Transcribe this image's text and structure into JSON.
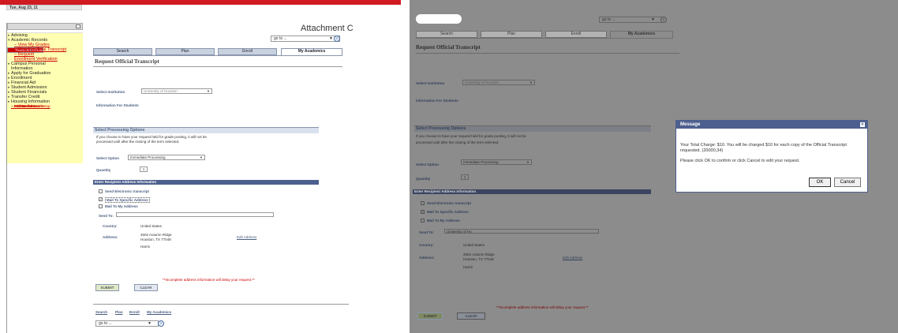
{
  "header": {
    "date": "Tue, Aug 23, 11",
    "attachment_label": "Attachment C"
  },
  "goto": {
    "value": "go to ...",
    "go_glyph": "»"
  },
  "nav": {
    "items": [
      {
        "label": "Advising",
        "arrow": "▸"
      },
      {
        "label": "Academic Records",
        "arrow": "▾"
      },
      {
        "label": "– View My Grades"
      },
      {
        "label": "– Request Official"
      },
      {
        "label": "Transcript"
      },
      {
        "label": "– View Unofficial Transcript"
      },
      {
        "label": "– Request"
      },
      {
        "label": "Enrollment Verification"
      },
      {
        "label": "Campus Personal",
        "arrow": "▸"
      },
      {
        "label": "Information"
      },
      {
        "label": "Apply for Graduation",
        "arrow": "▸"
      },
      {
        "label": "Enrollment",
        "arrow": "▸"
      },
      {
        "label": "Financial Aid",
        "arrow": "▸"
      },
      {
        "label": "Student Admission",
        "arrow": "▸"
      },
      {
        "label": "Student Financials",
        "arrow": "▸"
      },
      {
        "label": "Transfer Credit",
        "arrow": "▸"
      },
      {
        "label": "Housing Information",
        "arrow": "▸"
      },
      {
        "label": "– Student Center"
      },
      {
        "label": "– Password Reset/Setup"
      },
      {
        "label": "– ACS Website"
      },
      {
        "label": "– Self Service Home"
      }
    ]
  },
  "tabs": [
    "Search",
    "Plan",
    "Enroll",
    "My Academics"
  ],
  "page": {
    "title": "Request Official Transcript",
    "select_institution_label": "Select Institution",
    "institution_value": "University of Houston",
    "info_link": "Information For Students",
    "processing_section": "Select Processing Options",
    "processing_text_1": "If you choose to have your request held for grade posting, it will not be",
    "processing_text_2": "processed until after the closing of the term selected.",
    "select_option_label": "Select Option",
    "select_option_value": "Immediate Processing",
    "quantity_label": "Quantity",
    "quantity_value": "1",
    "address_section": "Enter Recipient Address Information",
    "opt_electronic": "Send Electronic transcript",
    "opt_mail_specific": "Mail To Specific Address",
    "opt_mail_my": "Mail To My Address",
    "send_to_label": "Send To:",
    "send_to_value_right": "University of Ho",
    "country_label": "Country:",
    "country_value": "United States",
    "address_label": "Address:",
    "address_line1": "4602 Autumn Ridge",
    "address_line2": "Houston, TX 77048",
    "address_line3": "Harris",
    "edit_address": "Edit Address",
    "warning": "**Incomplete address information will delay your request.**",
    "submit": "SUBMIT",
    "clear": "CLEAR"
  },
  "footer": {
    "links": [
      "Search",
      "Plan",
      "Enroll",
      "My Academics"
    ]
  },
  "dialog": {
    "title": "Message",
    "message_1": "Your Total Charge: $10. You will be charged $10 for each copy of the Official Transcript requested. (20000,34)",
    "message_2": "Please click OK to confirm or click Cancel to edit your request.",
    "ok": "OK",
    "cancel": "Cancel"
  }
}
